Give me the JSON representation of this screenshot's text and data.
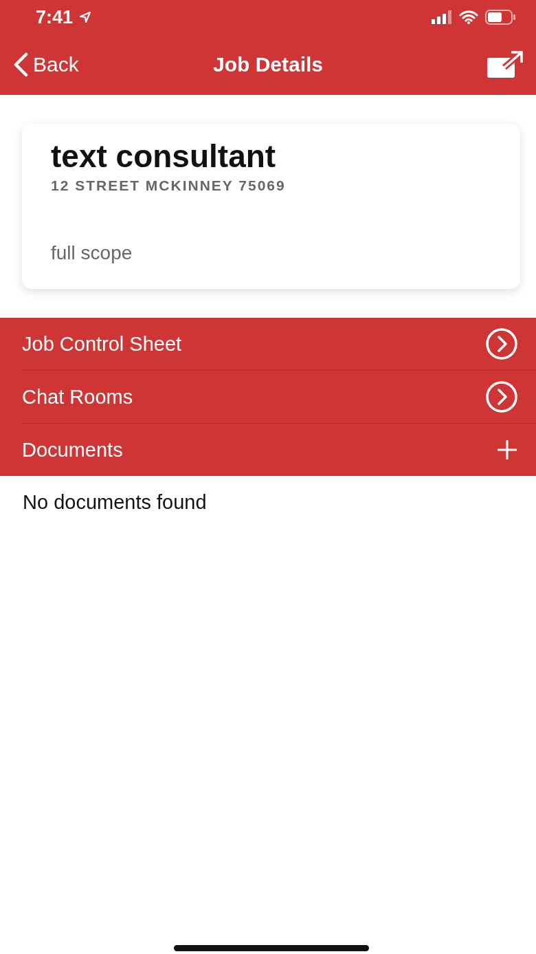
{
  "status_bar": {
    "time": "7:41"
  },
  "nav": {
    "back": "Back",
    "title": "Job Details"
  },
  "job": {
    "title": "text consultant",
    "address": "12 STREET MCKINNEY 75069",
    "scope": "full scope"
  },
  "sections": [
    {
      "label": "Job Control Sheet",
      "kind": "link"
    },
    {
      "label": "Chat Rooms",
      "kind": "link"
    },
    {
      "label": "Documents",
      "kind": "add"
    }
  ],
  "documents_empty": "No documents found"
}
